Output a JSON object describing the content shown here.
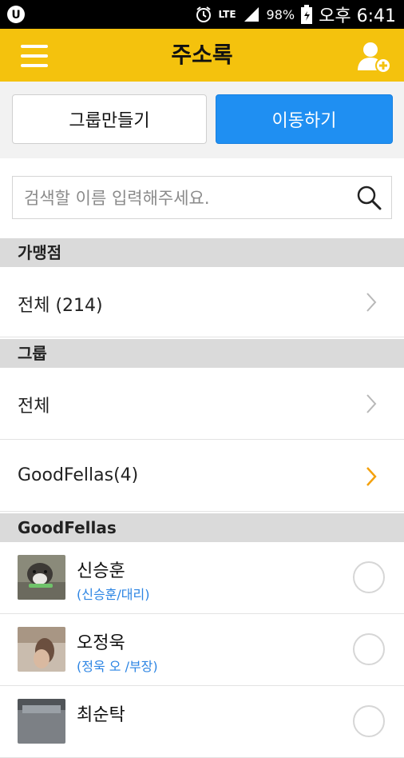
{
  "status": {
    "battery": "98%",
    "time": "오후 6:41",
    "network": "LTE"
  },
  "appbar": {
    "title": "주소록"
  },
  "actions": {
    "group_label": "그룹만들기",
    "move_label": "이동하기"
  },
  "search": {
    "placeholder": "검색할 이름 입력해주세요."
  },
  "sections": {
    "store": {
      "title": "가맹점",
      "all_label": "전체 (214)"
    },
    "group": {
      "title": "그룹",
      "all_label": "전체",
      "item_label": "GoodFellas(4)"
    },
    "goodfellas": {
      "title": "GoodFellas"
    }
  },
  "contacts": [
    {
      "name": "신승훈",
      "sub": "(신승훈/대리)"
    },
    {
      "name": "오정욱",
      "sub": "(정욱 오 /부장)"
    },
    {
      "name": "최순탁",
      "sub": ""
    }
  ],
  "colors": {
    "accent": "#f4c20d",
    "primary": "#1f8ff2",
    "link": "#2b84e3",
    "chevron_active": "#f4a10d"
  }
}
